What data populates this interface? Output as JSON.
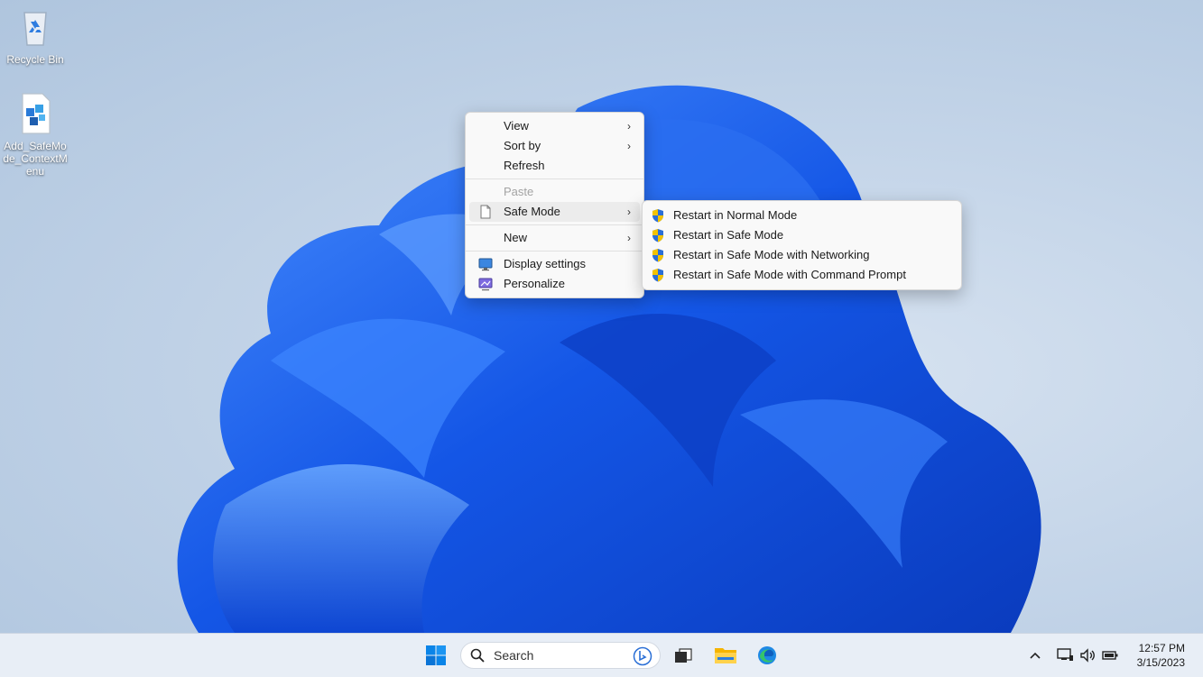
{
  "desktop": {
    "icons": [
      {
        "label": "Recycle Bin"
      },
      {
        "label": "Add_SafeMode_ContextMenu"
      }
    ]
  },
  "context_menu": {
    "items": [
      {
        "label": "View",
        "submenu": true
      },
      {
        "label": "Sort by",
        "submenu": true
      },
      {
        "label": "Refresh"
      },
      {
        "label": "Paste",
        "disabled": true
      },
      {
        "label": "Safe Mode",
        "submenu": true
      },
      {
        "label": "New",
        "submenu": true
      },
      {
        "label": "Display settings"
      },
      {
        "label": "Personalize"
      }
    ]
  },
  "safe_mode_submenu": {
    "items": [
      {
        "label": "Restart in Normal Mode"
      },
      {
        "label": "Restart in Safe Mode"
      },
      {
        "label": "Restart in Safe Mode with Networking"
      },
      {
        "label": "Restart in Safe Mode with Command Prompt"
      }
    ]
  },
  "taskbar": {
    "search_label": "Search",
    "time": "12:57 PM",
    "date": "3/15/2023"
  },
  "colors": {
    "accent": "#0067c0",
    "wallpaper_blue": "#1a5fe0"
  }
}
